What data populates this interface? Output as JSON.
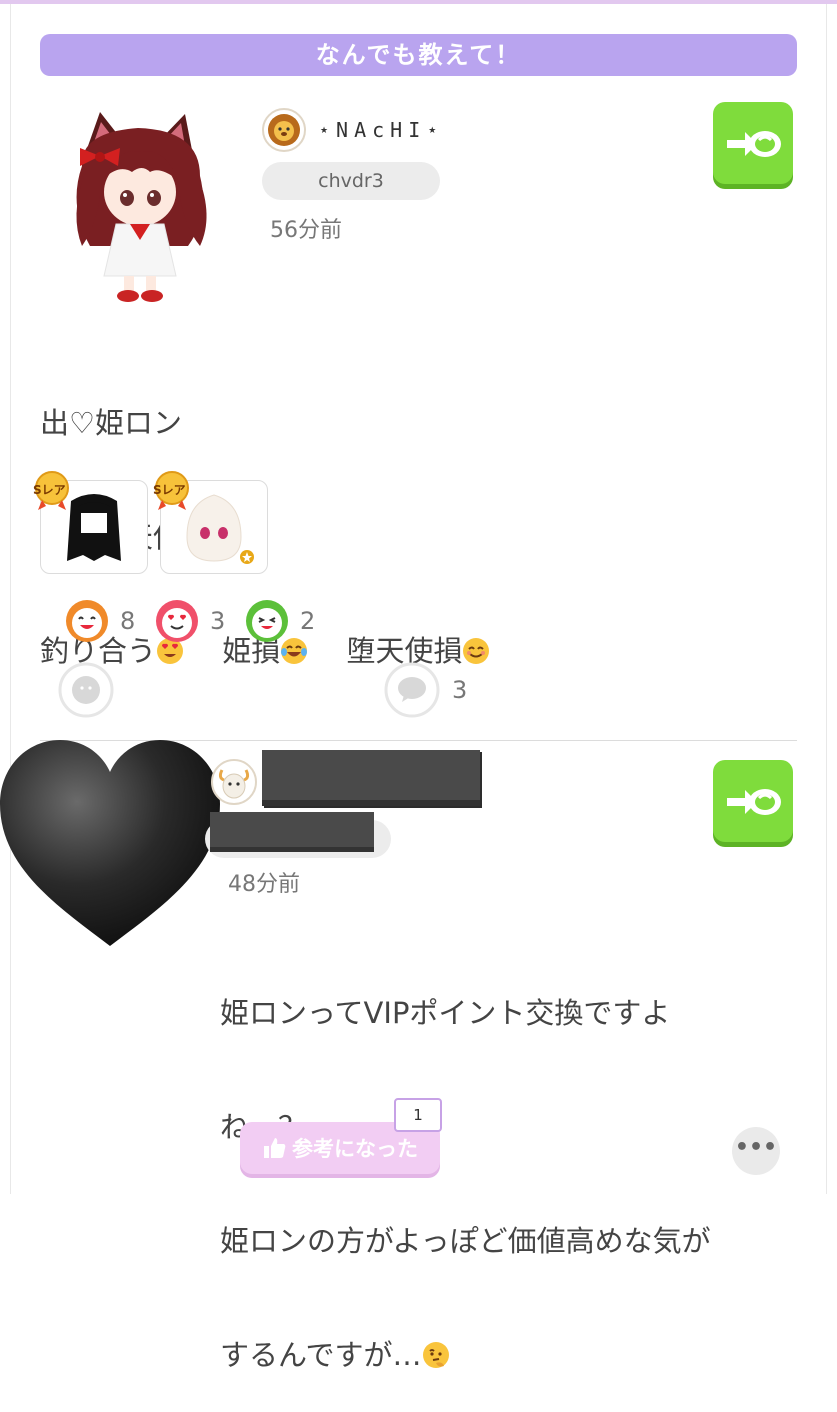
{
  "header": {
    "title": "なんでも教えて！"
  },
  "post": {
    "username": "⋆NAcHI⋆",
    "user_id": "chvdr3",
    "time": "56分前",
    "lines": [
      {
        "text": "出♡姫ロン",
        "trail": []
      },
      {
        "text": "求♡堕天使DU後",
        "trail": []
      },
      {
        "text": "釣り合う",
        "trail": [
          "heart-eyes",
          "姫損",
          "tears-of-joy",
          "堕天使損",
          "smile"
        ]
      }
    ],
    "line3_part2": "姫損",
    "line3_part3": "堕天使損",
    "items": [
      {
        "rarity": "Sレア",
        "name": "black-hair-item"
      },
      {
        "rarity": "Sレア",
        "name": "white-onigiri-face-item"
      }
    ],
    "reactions": [
      {
        "icon": "laugh-face-icon",
        "count": "8",
        "color": "#f08a2a"
      },
      {
        "icon": "love-face-icon",
        "count": "3",
        "color": "#f0506a"
      },
      {
        "icon": "grin-face-icon",
        "count": "2",
        "color": "#5cc03a"
      }
    ],
    "comment_count": "3"
  },
  "comment": {
    "time": "48分前",
    "text_lines": [
      "姫ロンってVIPポイント交換ですよ",
      "ね…？",
      "姫ロンの方がよっぽど価値高めな気が",
      "するんですが…"
    ],
    "helpful_label": "参考になった",
    "helpful_count": "1",
    "more_label": "•••"
  },
  "colors": {
    "banner": "#b9a4ef",
    "trade_button": "#7fdc3c",
    "helpful_button": "#f2cdf3"
  }
}
